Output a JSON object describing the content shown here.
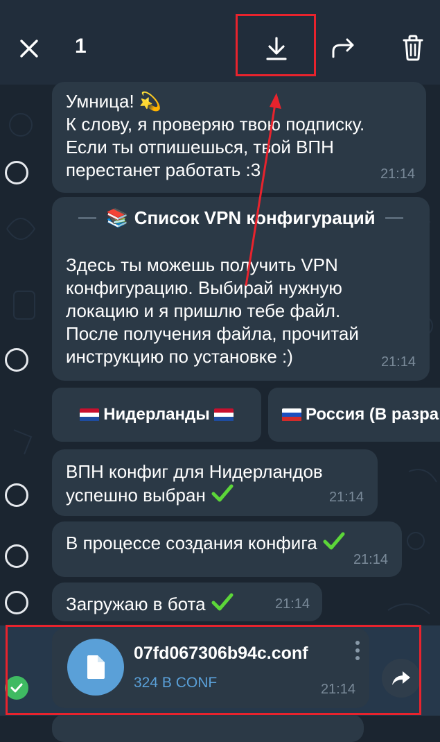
{
  "topbar": {
    "selected_count": "1",
    "icons": [
      "close-icon",
      "download-icon",
      "forward-icon",
      "trash-icon"
    ]
  },
  "messages": [
    {
      "text": "Умница! 💫\nК слову, я проверяю твою подписку.\nЕсли ты отпишешься, твой ВПН\nперестанет работать :3",
      "time": "21:14"
    },
    {
      "title": "Список VPN конфигураций",
      "title_emoji": "📚",
      "text": "Здесь ты можешь получить VPN\nконфигурацию. Выбирай нужную\nлокацию и я пришлю тебе файл.\nПосле получения файла, прочитай\nинструкцию по установке :)",
      "time": "21:14"
    },
    {
      "text": "ВПН конфиг для Нидерландов\nуспешно выбран",
      "time": "21:14"
    },
    {
      "text": "В процессе создания конфига",
      "time": "21:14"
    },
    {
      "text": "Загружаю в бота",
      "time": "21:14"
    }
  ],
  "keyboard": [
    {
      "label": "Нидерланды"
    },
    {
      "label": "Россия (В разра"
    }
  ],
  "file": {
    "name": "07fd067306b94c.conf",
    "meta": "324 B CONF",
    "time": "21:14",
    "icon": "document-icon"
  },
  "colors": {
    "accent": "#5aa0d8",
    "checkmark": "#5cd639",
    "selected": "#3fba62",
    "highlight": "#e8232d"
  }
}
